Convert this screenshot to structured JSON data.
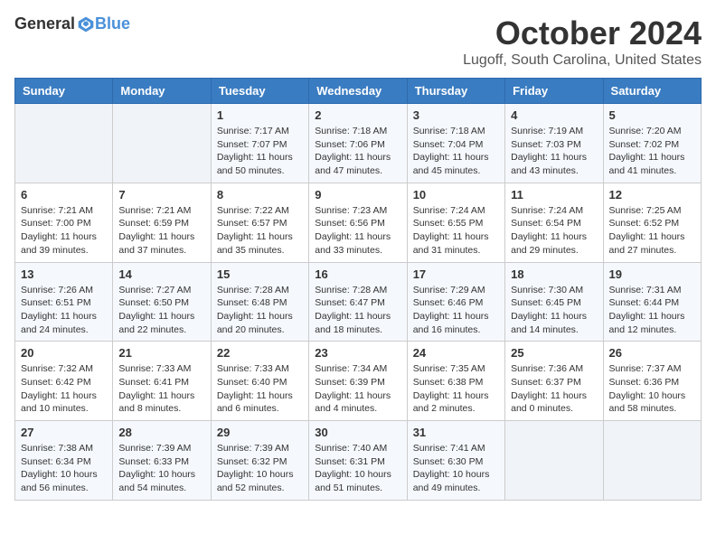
{
  "header": {
    "logo_general": "General",
    "logo_blue": "Blue",
    "month_title": "October 2024",
    "location": "Lugoff, South Carolina, United States"
  },
  "weekdays": [
    "Sunday",
    "Monday",
    "Tuesday",
    "Wednesday",
    "Thursday",
    "Friday",
    "Saturday"
  ],
  "weeks": [
    [
      {
        "day": "",
        "info": ""
      },
      {
        "day": "",
        "info": ""
      },
      {
        "day": "1",
        "info": "Sunrise: 7:17 AM\nSunset: 7:07 PM\nDaylight: 11 hours and 50 minutes."
      },
      {
        "day": "2",
        "info": "Sunrise: 7:18 AM\nSunset: 7:06 PM\nDaylight: 11 hours and 47 minutes."
      },
      {
        "day": "3",
        "info": "Sunrise: 7:18 AM\nSunset: 7:04 PM\nDaylight: 11 hours and 45 minutes."
      },
      {
        "day": "4",
        "info": "Sunrise: 7:19 AM\nSunset: 7:03 PM\nDaylight: 11 hours and 43 minutes."
      },
      {
        "day": "5",
        "info": "Sunrise: 7:20 AM\nSunset: 7:02 PM\nDaylight: 11 hours and 41 minutes."
      }
    ],
    [
      {
        "day": "6",
        "info": "Sunrise: 7:21 AM\nSunset: 7:00 PM\nDaylight: 11 hours and 39 minutes."
      },
      {
        "day": "7",
        "info": "Sunrise: 7:21 AM\nSunset: 6:59 PM\nDaylight: 11 hours and 37 minutes."
      },
      {
        "day": "8",
        "info": "Sunrise: 7:22 AM\nSunset: 6:57 PM\nDaylight: 11 hours and 35 minutes."
      },
      {
        "day": "9",
        "info": "Sunrise: 7:23 AM\nSunset: 6:56 PM\nDaylight: 11 hours and 33 minutes."
      },
      {
        "day": "10",
        "info": "Sunrise: 7:24 AM\nSunset: 6:55 PM\nDaylight: 11 hours and 31 minutes."
      },
      {
        "day": "11",
        "info": "Sunrise: 7:24 AM\nSunset: 6:54 PM\nDaylight: 11 hours and 29 minutes."
      },
      {
        "day": "12",
        "info": "Sunrise: 7:25 AM\nSunset: 6:52 PM\nDaylight: 11 hours and 27 minutes."
      }
    ],
    [
      {
        "day": "13",
        "info": "Sunrise: 7:26 AM\nSunset: 6:51 PM\nDaylight: 11 hours and 24 minutes."
      },
      {
        "day": "14",
        "info": "Sunrise: 7:27 AM\nSunset: 6:50 PM\nDaylight: 11 hours and 22 minutes."
      },
      {
        "day": "15",
        "info": "Sunrise: 7:28 AM\nSunset: 6:48 PM\nDaylight: 11 hours and 20 minutes."
      },
      {
        "day": "16",
        "info": "Sunrise: 7:28 AM\nSunset: 6:47 PM\nDaylight: 11 hours and 18 minutes."
      },
      {
        "day": "17",
        "info": "Sunrise: 7:29 AM\nSunset: 6:46 PM\nDaylight: 11 hours and 16 minutes."
      },
      {
        "day": "18",
        "info": "Sunrise: 7:30 AM\nSunset: 6:45 PM\nDaylight: 11 hours and 14 minutes."
      },
      {
        "day": "19",
        "info": "Sunrise: 7:31 AM\nSunset: 6:44 PM\nDaylight: 11 hours and 12 minutes."
      }
    ],
    [
      {
        "day": "20",
        "info": "Sunrise: 7:32 AM\nSunset: 6:42 PM\nDaylight: 11 hours and 10 minutes."
      },
      {
        "day": "21",
        "info": "Sunrise: 7:33 AM\nSunset: 6:41 PM\nDaylight: 11 hours and 8 minutes."
      },
      {
        "day": "22",
        "info": "Sunrise: 7:33 AM\nSunset: 6:40 PM\nDaylight: 11 hours and 6 minutes."
      },
      {
        "day": "23",
        "info": "Sunrise: 7:34 AM\nSunset: 6:39 PM\nDaylight: 11 hours and 4 minutes."
      },
      {
        "day": "24",
        "info": "Sunrise: 7:35 AM\nSunset: 6:38 PM\nDaylight: 11 hours and 2 minutes."
      },
      {
        "day": "25",
        "info": "Sunrise: 7:36 AM\nSunset: 6:37 PM\nDaylight: 11 hours and 0 minutes."
      },
      {
        "day": "26",
        "info": "Sunrise: 7:37 AM\nSunset: 6:36 PM\nDaylight: 10 hours and 58 minutes."
      }
    ],
    [
      {
        "day": "27",
        "info": "Sunrise: 7:38 AM\nSunset: 6:34 PM\nDaylight: 10 hours and 56 minutes."
      },
      {
        "day": "28",
        "info": "Sunrise: 7:39 AM\nSunset: 6:33 PM\nDaylight: 10 hours and 54 minutes."
      },
      {
        "day": "29",
        "info": "Sunrise: 7:39 AM\nSunset: 6:32 PM\nDaylight: 10 hours and 52 minutes."
      },
      {
        "day": "30",
        "info": "Sunrise: 7:40 AM\nSunset: 6:31 PM\nDaylight: 10 hours and 51 minutes."
      },
      {
        "day": "31",
        "info": "Sunrise: 7:41 AM\nSunset: 6:30 PM\nDaylight: 10 hours and 49 minutes."
      },
      {
        "day": "",
        "info": ""
      },
      {
        "day": "",
        "info": ""
      }
    ]
  ]
}
